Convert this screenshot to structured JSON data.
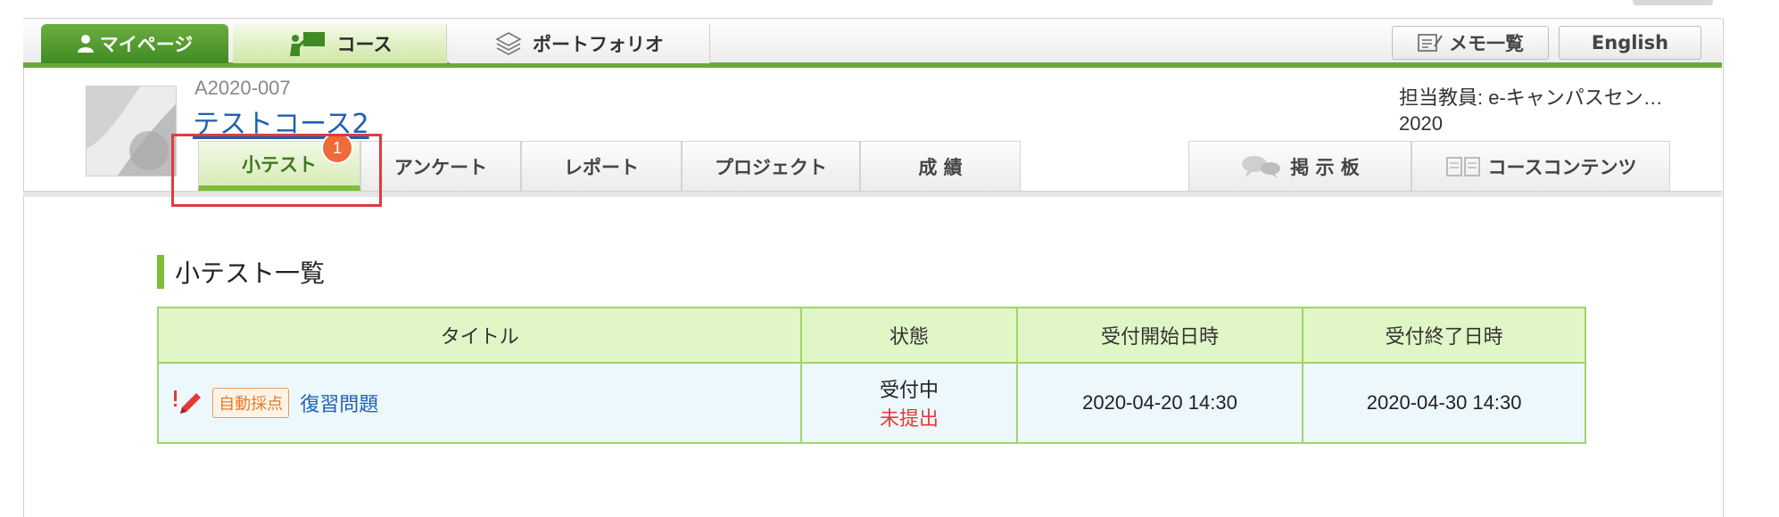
{
  "nav": {
    "mypage": "マイページ",
    "course": "コース",
    "portfolio": "ポートフォリオ",
    "memo": "メモ一覧",
    "english": "English"
  },
  "course": {
    "code": "A2020-007",
    "title": "テストコース2",
    "teacher": "担当教員: e-キャンパスセン…",
    "year": "2020"
  },
  "subtabs": {
    "quiz": "小テスト",
    "quiz_badge": "1",
    "survey": "アンケート",
    "report": "レポート",
    "project": "プロジェクト",
    "grades": "成 績",
    "board": "掲 示 板",
    "contents": "コースコンテンツ"
  },
  "section": {
    "title": "小テスト一覧"
  },
  "table": {
    "headers": [
      "タイトル",
      "状態",
      "受付開始日時",
      "受付終了日時"
    ],
    "rows": [
      {
        "tag": "自動採点",
        "title": "復習問題",
        "status": "受付中",
        "status_sub": "未提出",
        "start": "2020-04-20 14:30",
        "end": "2020-04-30 14:30"
      }
    ]
  },
  "colors": {
    "accent_green": "#6ba83b",
    "link_blue": "#1f5fb4",
    "alert_red": "#e03b3b",
    "badge_orange": "#ee6b3a"
  }
}
